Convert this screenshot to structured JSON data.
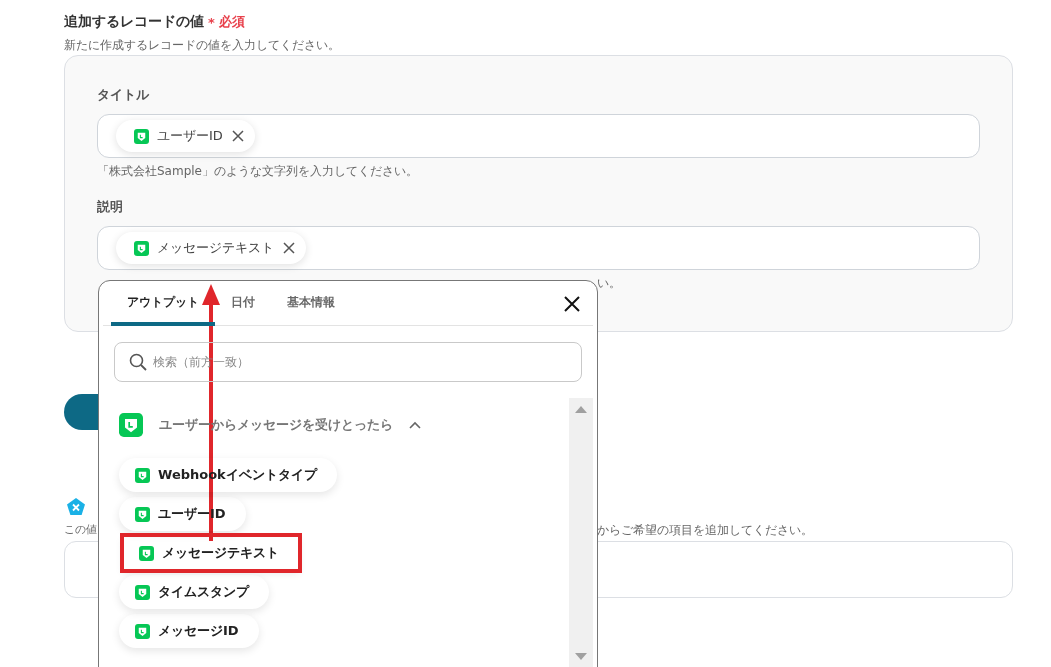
{
  "header": {
    "title": "追加するレコードの値",
    "required_mark": "*",
    "required_label": "必須",
    "description": "新たに作成するレコードの値を入力してください。"
  },
  "fields": [
    {
      "label": "タイトル",
      "tokens": [
        {
          "text": "ユーザーID"
        }
      ],
      "hint": "「株式会社Sample」のような文字列を入力してください。"
    },
    {
      "label": "説明",
      "tokens": [
        {
          "text": "メッセージテキスト"
        }
      ],
      "hint": "い。"
    }
  ],
  "section2": {
    "hint_left": "この値",
    "hint_right": "からご希望の項目を追加してください。"
  },
  "popover": {
    "tabs": [
      {
        "label": "アウトプット",
        "selected": true
      },
      {
        "label": "日付",
        "selected": false
      },
      {
        "label": "基本情報",
        "selected": false
      }
    ],
    "search": {
      "placeholder": "検索（前方一致）"
    },
    "group": {
      "title": "ユーザーからメッセージを受けとったら",
      "expanded": true,
      "items": [
        {
          "text": "Webhookイベントタイプ",
          "highlighted": false
        },
        {
          "text": "ユーザーID",
          "highlighted": false
        },
        {
          "text": "メッセージテキスト",
          "highlighted": true
        },
        {
          "text": "タイムスタンプ",
          "highlighted": false
        },
        {
          "text": "メッセージID",
          "highlighted": false
        }
      ]
    }
  }
}
